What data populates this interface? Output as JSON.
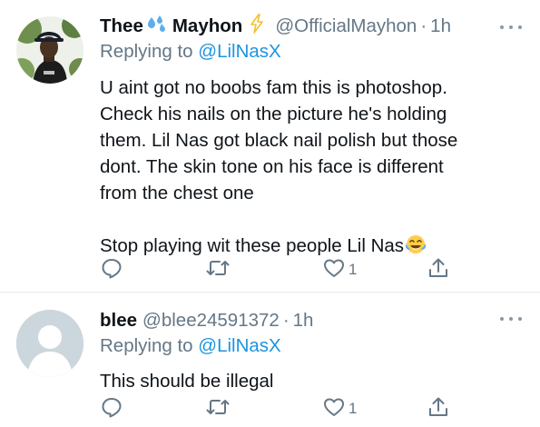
{
  "tweets": [
    {
      "display_name_1": "Thee",
      "display_name_2": "Mayhon",
      "handle": "@OfficialMayhon",
      "separator": "·",
      "time": "1h",
      "replying_prefix": "Replying to",
      "replying_to": "@LilNasX",
      "body_lines": [
        "U aint got no boobs fam this is photoshop.",
        "Check his nails on the picture he's holding",
        "them. Lil Nas got black nail polish but those",
        "dont. The skin tone on his face is different",
        "from the chest one",
        "",
        "Stop playing wit these people Lil Nas"
      ],
      "like_count": "1",
      "icons": [
        "droplets-emoji",
        "high-voltage-emoji",
        "tears-of-joy-emoji",
        "reply-icon",
        "retweet-icon",
        "heart-icon",
        "share-icon",
        "more-icon"
      ]
    },
    {
      "display_name": "blee",
      "handle": "@blee24591372",
      "separator": "·",
      "time": "1h",
      "replying_prefix": "Replying to",
      "replying_to": "@LilNasX",
      "body": "This should be illegal",
      "like_count": "1",
      "icons": [
        "default-avatar",
        "reply-icon",
        "retweet-icon",
        "heart-icon",
        "share-icon",
        "more-icon"
      ]
    }
  ],
  "colors": {
    "text": "#0f1419",
    "secondary": "#657786",
    "link": "#1b95e0",
    "divider": "#e6ecf0",
    "icon": "#657786"
  }
}
